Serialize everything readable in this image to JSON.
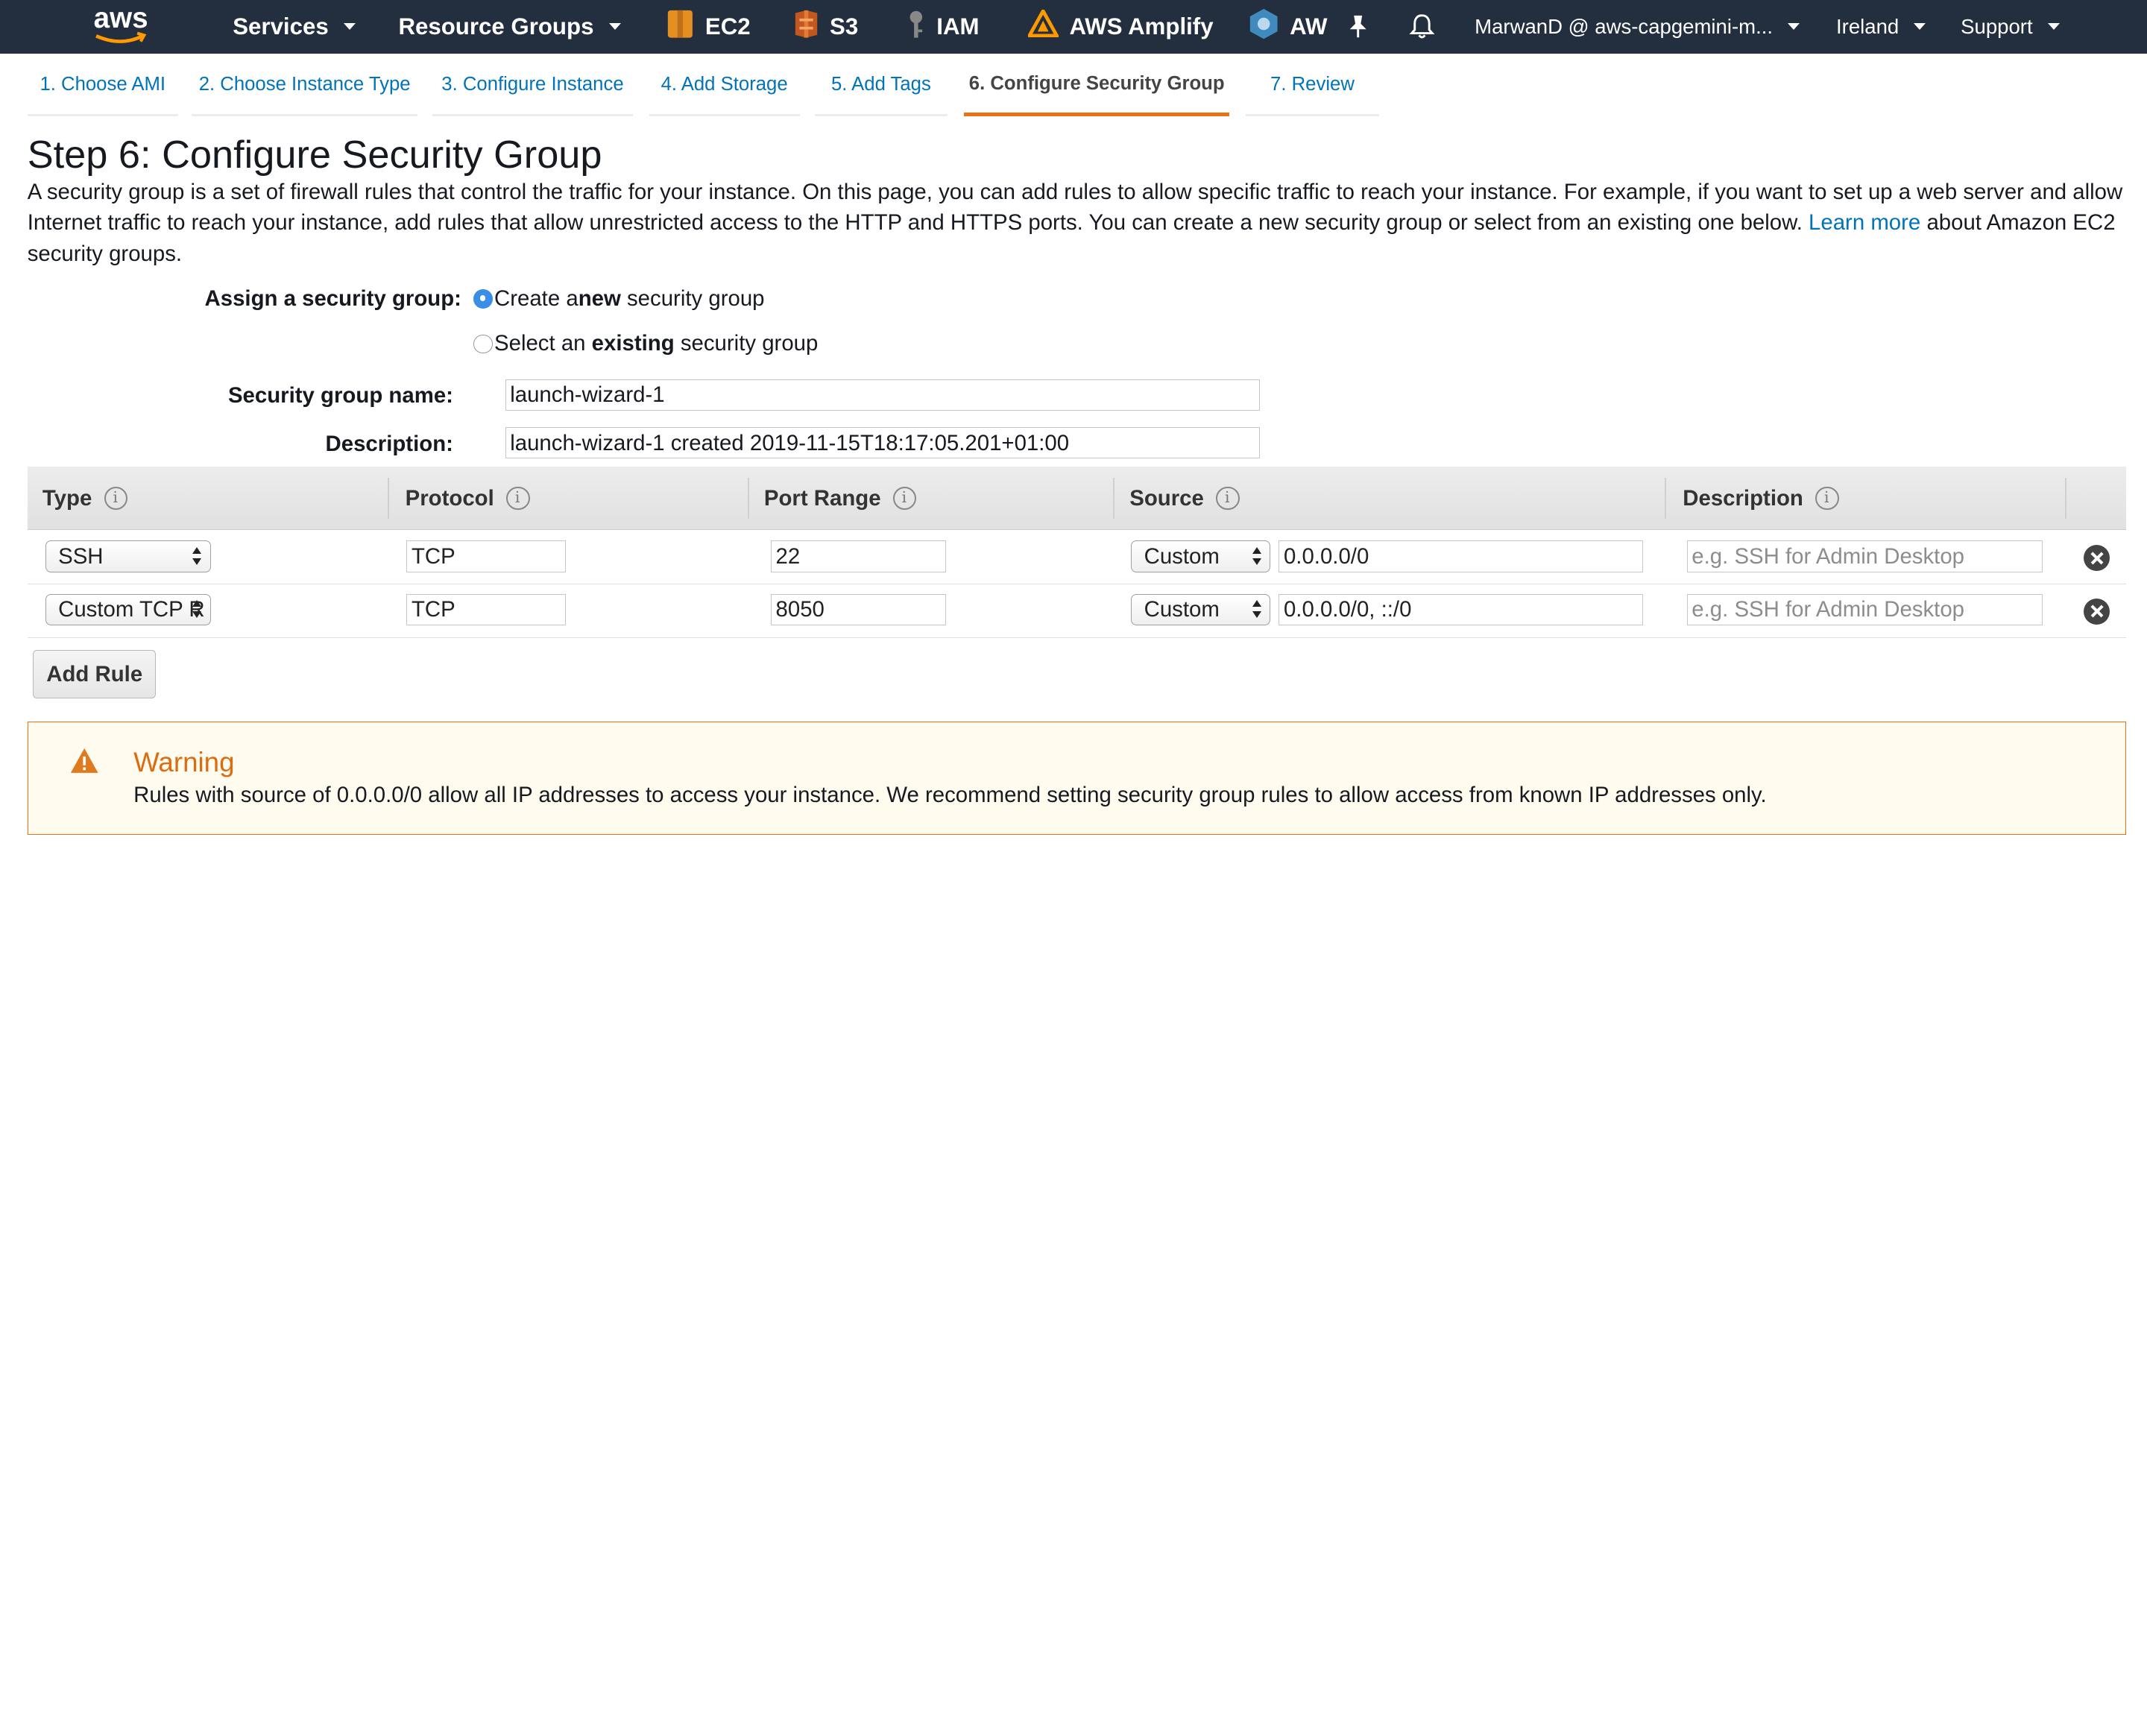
{
  "nav": {
    "brand": "aws",
    "services_label": "Services",
    "resource_groups_label": "Resource Groups",
    "pinned": [
      {
        "label": "EC2",
        "icon": "ec2-icon"
      },
      {
        "label": "S3",
        "icon": "s3-icon"
      },
      {
        "label": "IAM",
        "icon": "iam-icon"
      },
      {
        "label": "AWS Amplify",
        "icon": "amplify-icon"
      },
      {
        "label": "AW",
        "icon": "service-icon"
      }
    ],
    "account": "MarwanD @ aws-capgemini-m...",
    "region": "Ireland",
    "support": "Support"
  },
  "wizard": {
    "tabs": [
      "1. Choose AMI",
      "2. Choose Instance Type",
      "3. Configure Instance",
      "4. Add Storage",
      "5. Add Tags",
      "6. Configure Security Group",
      "7. Review"
    ],
    "active_tab": 5
  },
  "page": {
    "title": "Step 6: Configure Security Group",
    "intro_before_link": "A security group is a set of firewall rules that control the traffic for your instance. On this page, you can add rules to allow specific traffic to reach your instance. For example, if you want to set up a web server and allow Internet traffic to reach your instance, add rules that allow unrestricted access to the HTTP and HTTPS ports. You can create a new security group or select from an existing one below.",
    "learn_more": "Learn more",
    "intro_after_link": "about Amazon EC2 security groups."
  },
  "form": {
    "assign_label": "Assign a security group:",
    "option_new": {
      "pre": "Create a ",
      "bold": "new",
      "post": " security group",
      "checked": true
    },
    "option_existing": {
      "pre": "Select an ",
      "bold": "existing",
      "post": " security group",
      "checked": false
    },
    "name_label": "Security group name:",
    "name_value": "launch-wizard-1",
    "description_label": "Description:",
    "description_value": "launch-wizard-1 created 2019-11-15T18:17:05.201+01:00"
  },
  "rules": {
    "columns": [
      "Type",
      "Protocol",
      "Port Range",
      "Source",
      "Description"
    ],
    "rows": [
      {
        "type": "SSH",
        "protocol": "TCP",
        "port": "22",
        "source_mode": "Custom",
        "source": "0.0.0.0/0",
        "description_placeholder": "e.g. SSH for Admin Desktop"
      },
      {
        "type": "Custom TCP R",
        "protocol": "TCP",
        "port": "8050",
        "source_mode": "Custom",
        "source": "0.0.0.0/0, ::/0",
        "description_placeholder": "e.g. SSH for Admin Desktop"
      }
    ],
    "add_rule_label": "Add Rule"
  },
  "warning": {
    "title": "Warning",
    "text": "Rules with source of 0.0.0.0/0 allow all IP addresses to access your instance. We recommend setting security group rules to allow access from known IP addresses only."
  },
  "colors": {
    "nav_bg": "#232f3e",
    "link": "#0073bb",
    "accent": "#ec7211",
    "radio_selected": "#3a8ee6",
    "warning_bg": "#fffbef"
  }
}
